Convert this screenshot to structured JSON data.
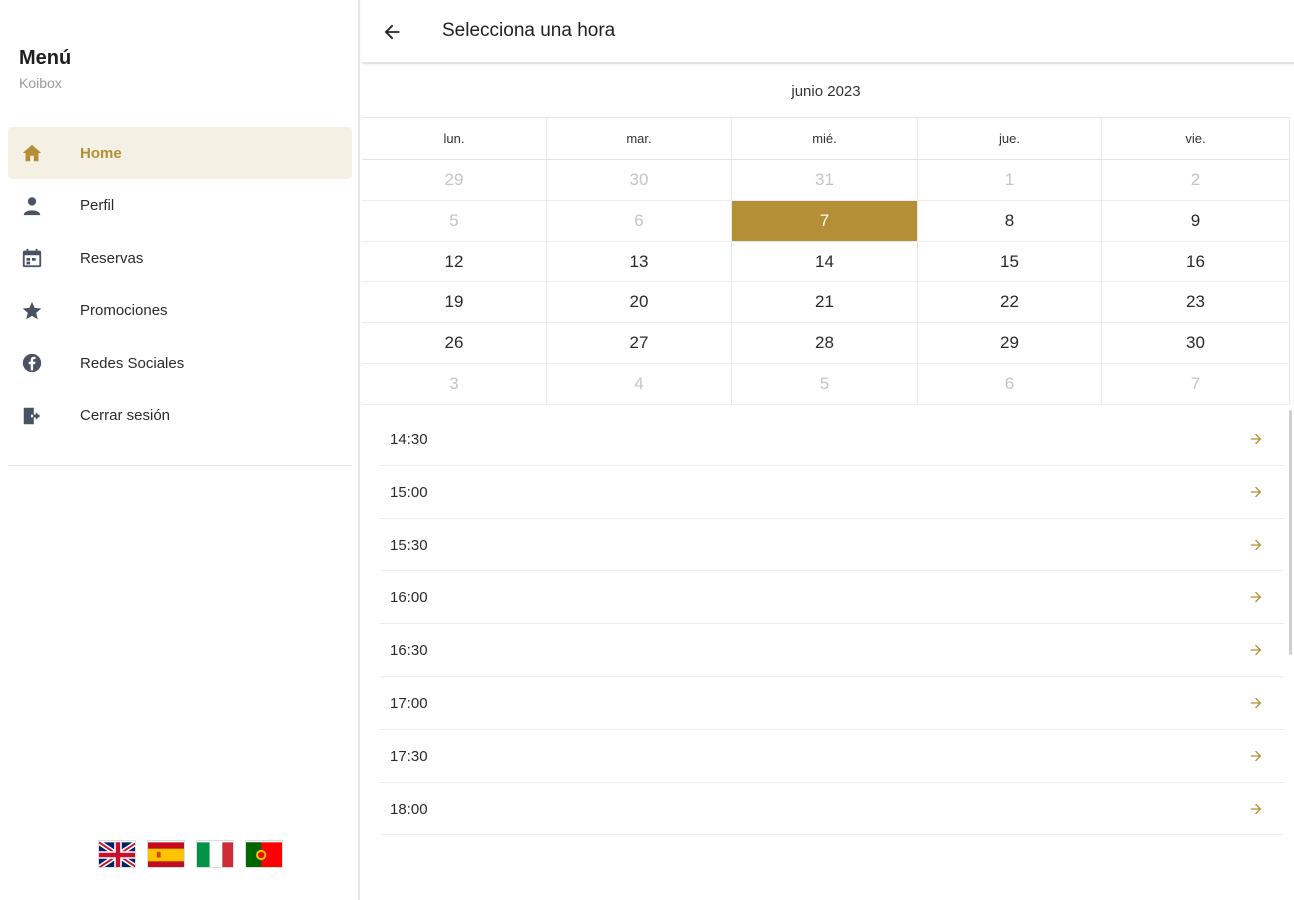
{
  "sidebar": {
    "title": "Menú",
    "subtitle": "Koibox",
    "items": [
      {
        "label": "Home",
        "icon": "home-icon",
        "active": true
      },
      {
        "label": "Perfil",
        "icon": "person-icon",
        "active": false
      },
      {
        "label": "Reservas",
        "icon": "calendar-icon",
        "active": false
      },
      {
        "label": "Promociones",
        "icon": "star-icon",
        "active": false
      },
      {
        "label": "Redes Sociales",
        "icon": "facebook-icon",
        "active": false
      },
      {
        "label": "Cerrar sesión",
        "icon": "logout-icon",
        "active": false
      }
    ],
    "flags": [
      "uk-flag-icon",
      "spain-flag-icon",
      "italy-flag-icon",
      "portugal-flag-icon"
    ]
  },
  "header": {
    "title": "Selecciona una hora"
  },
  "calendar": {
    "month": "junio 2023",
    "weekdays": [
      "lun.",
      "mar.",
      "mié.",
      "jue.",
      "vie."
    ],
    "weeks": [
      [
        {
          "d": "29",
          "muted": true
        },
        {
          "d": "30",
          "muted": true
        },
        {
          "d": "31",
          "muted": true
        },
        {
          "d": "1",
          "muted": true
        },
        {
          "d": "2",
          "muted": true
        }
      ],
      [
        {
          "d": "5",
          "muted": true
        },
        {
          "d": "6",
          "muted": true
        },
        {
          "d": "7",
          "selected": true
        },
        {
          "d": "8"
        },
        {
          "d": "9"
        }
      ],
      [
        {
          "d": "12"
        },
        {
          "d": "13"
        },
        {
          "d": "14"
        },
        {
          "d": "15"
        },
        {
          "d": "16"
        }
      ],
      [
        {
          "d": "19"
        },
        {
          "d": "20"
        },
        {
          "d": "21"
        },
        {
          "d": "22"
        },
        {
          "d": "23"
        }
      ],
      [
        {
          "d": "26"
        },
        {
          "d": "27"
        },
        {
          "d": "28"
        },
        {
          "d": "29"
        },
        {
          "d": "30"
        }
      ],
      [
        {
          "d": "3",
          "muted": true
        },
        {
          "d": "4",
          "muted": true
        },
        {
          "d": "5",
          "muted": true
        },
        {
          "d": "6",
          "muted": true
        },
        {
          "d": "7",
          "muted": true
        }
      ]
    ]
  },
  "slots": [
    "14:30",
    "15:00",
    "15:30",
    "16:00",
    "16:30",
    "17:00",
    "17:30",
    "18:00"
  ],
  "colors": {
    "accent": "#b48f36",
    "active_bg": "#f4f0e4",
    "icon": "#4a5364"
  }
}
